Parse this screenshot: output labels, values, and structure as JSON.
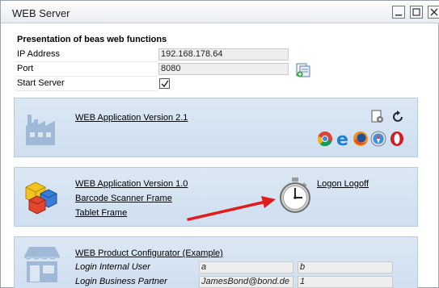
{
  "window": {
    "title": "WEB Server",
    "buttons": [
      "minimize",
      "maximize",
      "close"
    ]
  },
  "form": {
    "section_title": "Presentation of beas web functions",
    "rows": [
      {
        "label": "IP Address",
        "value": "192.168.178.64"
      },
      {
        "label": "Port",
        "value": "8080"
      },
      {
        "label": "Start Server",
        "checked": true
      }
    ]
  },
  "panel1": {
    "link": "WEB Application Version 2.1",
    "icons": [
      "factory-icon",
      "settings-document-icon",
      "refresh-icon",
      "chrome-icon",
      "internet-explorer-icon",
      "firefox-icon",
      "safari-icon",
      "opera-icon"
    ]
  },
  "panel2": {
    "links": [
      "WEB Application Version 1.0",
      "Barcode Scanner Frame",
      "Tablet Frame"
    ],
    "logon_link": "Logon Logoff",
    "icons": [
      "cubes-icon",
      "stopwatch-icon",
      "red-arrow-icon"
    ]
  },
  "panel3": {
    "link": "WEB Product Configurator (Example)",
    "rows": [
      {
        "label": "Login Internal User",
        "value1": "a",
        "value2": "b"
      },
      {
        "label": "Login Business Partner",
        "value1": "JamesBond@bond.de",
        "value2": "1"
      }
    ],
    "icons": [
      "shop-icon"
    ]
  },
  "colors": {
    "panel_bg": "#d5e3f1",
    "panel_border": "#b8cbe0",
    "arrow": "#e21b1b"
  }
}
